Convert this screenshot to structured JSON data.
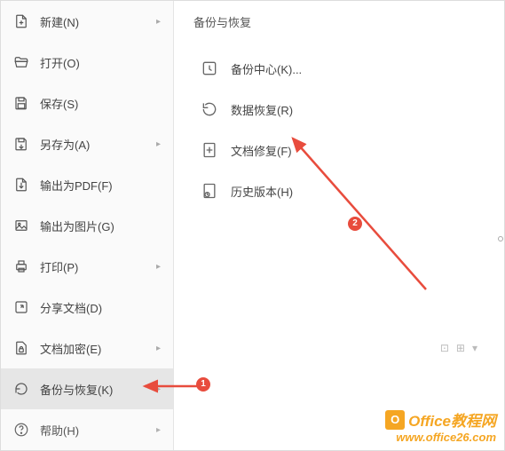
{
  "sidebar": {
    "items": [
      {
        "label": "新建(N)"
      },
      {
        "label": "打开(O)"
      },
      {
        "label": "保存(S)"
      },
      {
        "label": "另存为(A)"
      },
      {
        "label": "输出为PDF(F)"
      },
      {
        "label": "输出为图片(G)"
      },
      {
        "label": "打印(P)"
      },
      {
        "label": "分享文档(D)"
      },
      {
        "label": "文档加密(E)"
      },
      {
        "label": "备份与恢复(K)"
      },
      {
        "label": "帮助(H)"
      }
    ]
  },
  "content": {
    "title": "备份与恢复",
    "items": [
      {
        "label": "备份中心(K)..."
      },
      {
        "label": "数据恢复(R)"
      },
      {
        "label": "文档修复(F)"
      },
      {
        "label": "历史版本(H)"
      }
    ]
  },
  "annotations": {
    "badge1": "1",
    "badge2": "2"
  },
  "watermark": {
    "logo_letter": "O",
    "title": "Office教程网",
    "url": "www.office26.com"
  }
}
